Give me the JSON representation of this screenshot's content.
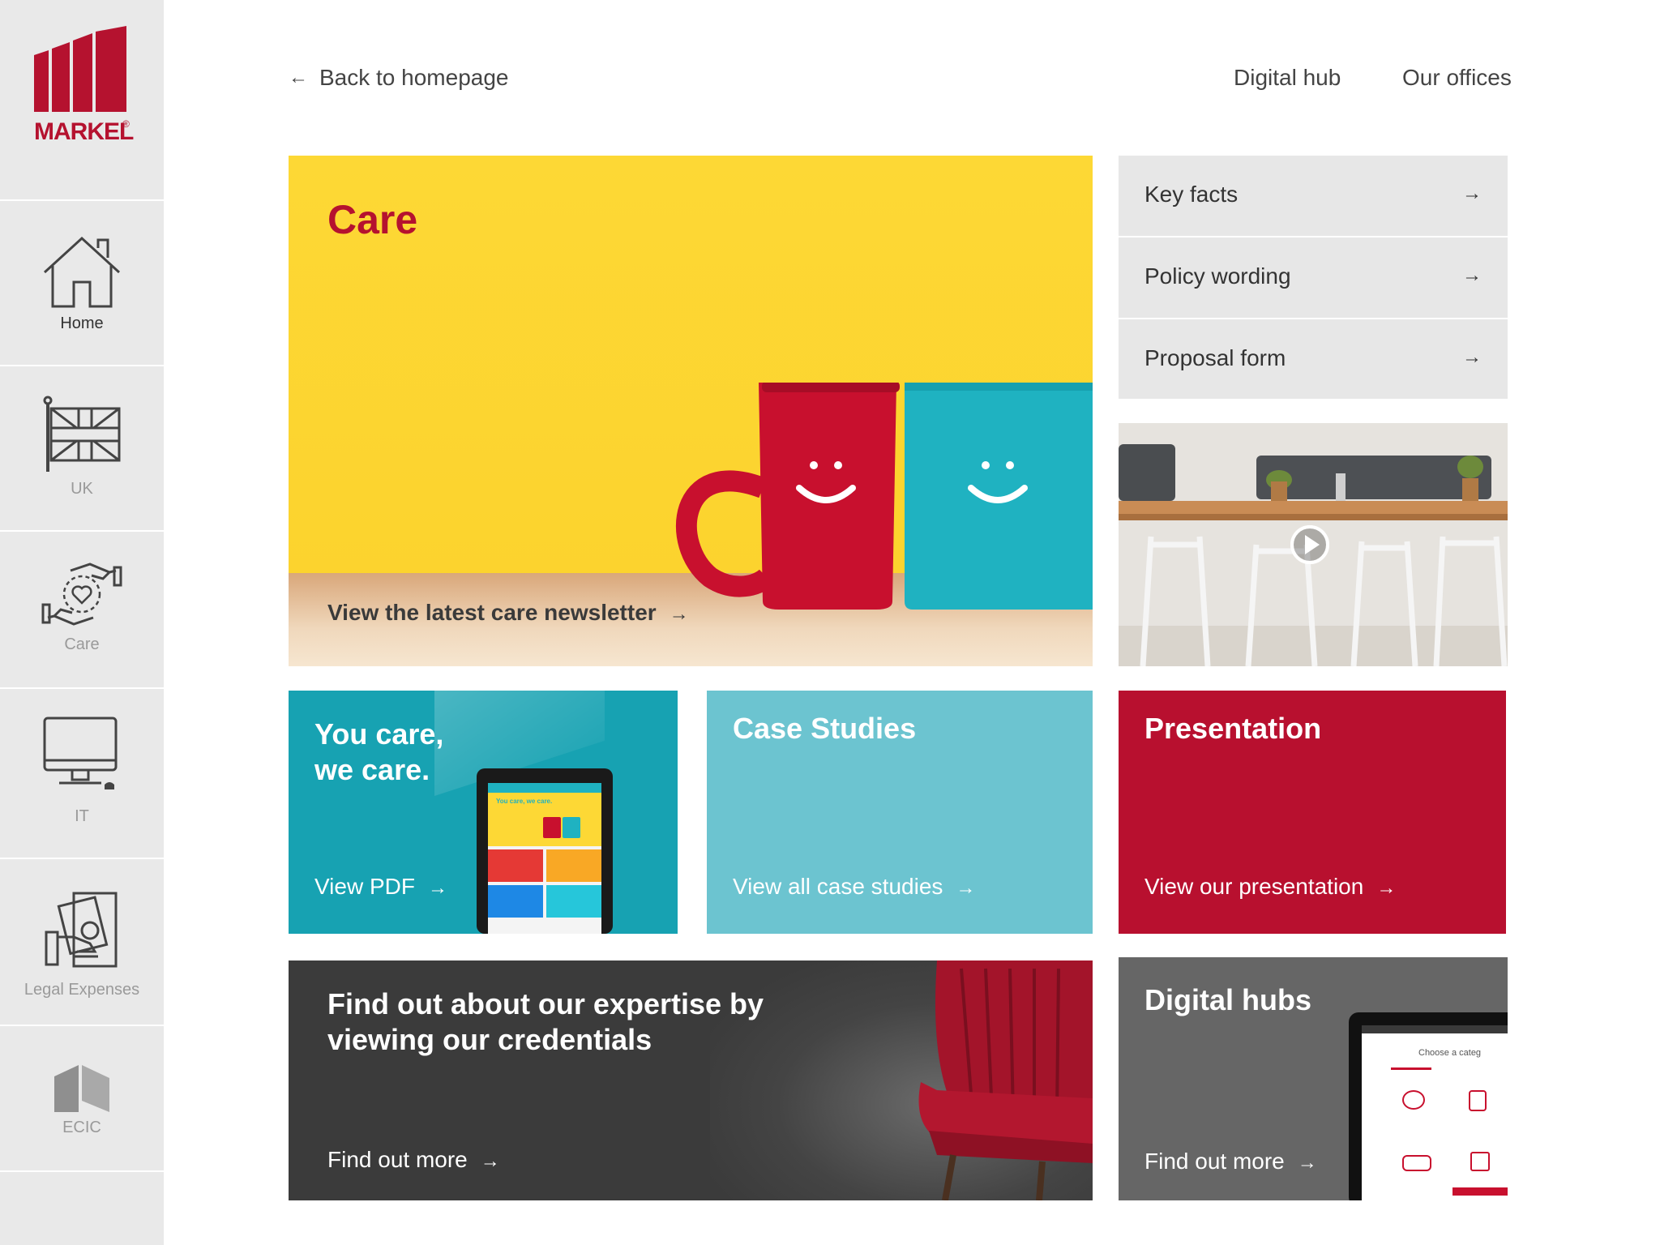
{
  "brand": {
    "logo_text": "MARKEL",
    "registered": "®",
    "brand_red": "#b5122f"
  },
  "header": {
    "back_label": "Back to homepage",
    "back_icon": "arrow-left-icon",
    "links": [
      "Digital hub",
      "Our offices"
    ]
  },
  "sidebar": {
    "items": [
      {
        "label": "Home",
        "icon": "home-icon",
        "active": true
      },
      {
        "label": "UK",
        "icon": "uk-flag-icon",
        "active": false
      },
      {
        "label": "Care",
        "icon": "care-hands-heart-icon",
        "active": false
      },
      {
        "label": "IT",
        "icon": "computer-monitor-icon",
        "active": false
      },
      {
        "label": "Legal Expenses",
        "icon": "legal-money-hand-icon",
        "active": false
      },
      {
        "label": "ECIC",
        "icon": "ecic-logo-icon",
        "active": false
      }
    ]
  },
  "hero": {
    "title": "Care",
    "cta": "View the latest care newsletter",
    "colors": {
      "background": "#fdd835",
      "title": "#b5122f",
      "cup_left": "#c8102e",
      "cup_right": "#1fb2c1"
    }
  },
  "quick_links": [
    {
      "label": "Key facts",
      "icon": "arrow-right-icon"
    },
    {
      "label": "Policy wording",
      "icon": "arrow-right-icon"
    },
    {
      "label": "Proposal form",
      "icon": "arrow-right-icon"
    }
  ],
  "video": {
    "icon": "play-icon"
  },
  "tiles": {
    "you_care": {
      "title_line1": "You care,",
      "title_line2": "we care.",
      "cta": "View PDF",
      "tablet_text": "You care, we care.",
      "color": "#17a2b2"
    },
    "case_studies": {
      "title": "Case Studies",
      "cta": "View all case studies",
      "color": "#6cc4d0"
    },
    "presentation": {
      "title": "Presentation",
      "cta": "View our presentation",
      "color": "#b8102f"
    },
    "credentials": {
      "title_line1": "Find out about our expertise by",
      "title_line2": "viewing our credentials",
      "cta": "Find out more",
      "color": "#3b3b3b"
    },
    "digital_hubs": {
      "title": "Digital hubs",
      "cta": "Find out more",
      "screen_text": "Choose a categ",
      "color": "#666666"
    }
  }
}
